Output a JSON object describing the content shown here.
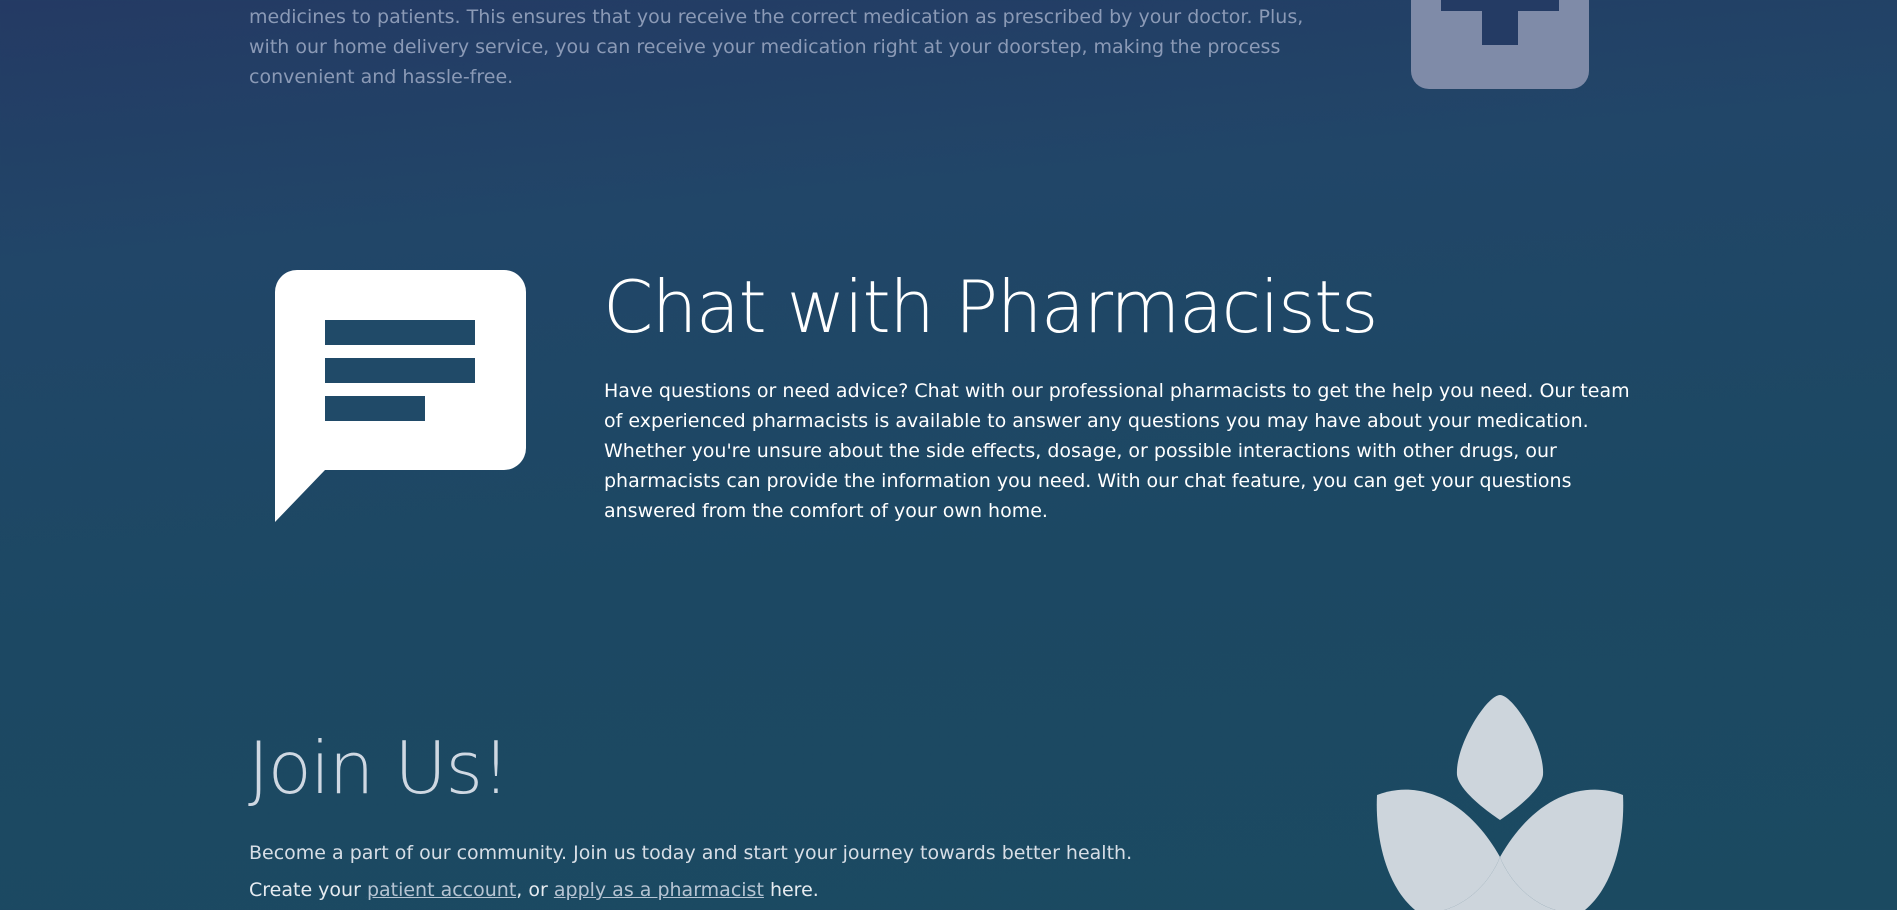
{
  "top_section": {
    "text": "medicines to patients. This ensures that you receive the correct medication as prescribed by your doctor. Plus, with our home delivery service, you can receive your medication right at your doorstep, making the process convenient and hassle-free.",
    "icon": "medical-cross-icon"
  },
  "chat_section": {
    "title": "Chat with Pharmacists",
    "text": "Have questions or need advice? Chat with our professional pharmacists to get the help you need. Our team of experienced pharmacists is available to answer any questions you may have about your medication. Whether you're unsure about the side effects, dosage, or possible interactions with other drugs, our pharmacists can provide the information you need. With our chat feature, you can get your questions answered from the comfort of your own home.",
    "icon": "chat-bubble-icon"
  },
  "join_section": {
    "title": "Join Us!",
    "line1": "Become a part of our community. Join us today and start your journey towards better health.",
    "line2_prefix": "Create your ",
    "patient_link": "patient account",
    "line2_middle": ", or ",
    "pharmacist_link": "apply as a pharmacist",
    "line2_suffix": " here.",
    "icon": "lotus-icon"
  },
  "colors": {
    "background_top": "#243a64",
    "background_bottom": "#1b4a61",
    "faded_text": "#8b9ab6",
    "faded_icon": "#7f8ba8",
    "chat_icon": "#ffffff",
    "lotus_icon": "#cdd5dc"
  }
}
